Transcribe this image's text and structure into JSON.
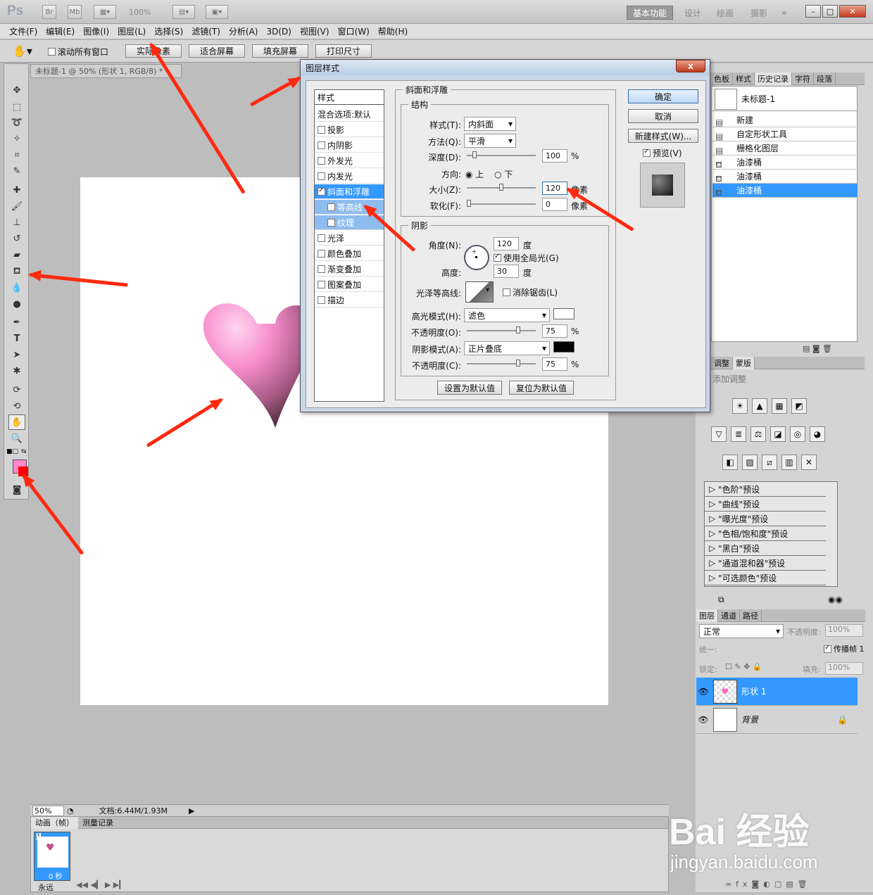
{
  "app": {
    "logo": "Ps",
    "zoom": "100%"
  },
  "topbar": {
    "br": "Br",
    "mb": "Mb",
    "workspaces": [
      "基本功能",
      "设计",
      "绘画",
      "摄影"
    ],
    "more": "»"
  },
  "menu": [
    "文件(F)",
    "编辑(E)",
    "图像(I)",
    "图层(L)",
    "选择(S)",
    "滤镜(T)",
    "分析(A)",
    "3D(D)",
    "视图(V)",
    "窗口(W)",
    "帮助(H)"
  ],
  "options": {
    "scroll_all": "滚动所有窗口",
    "actual_pixels": "实际像素",
    "fit_screen": "适合屏幕",
    "fill_screen": "填充屏幕",
    "print_size": "打印尺寸"
  },
  "document": {
    "tab": "未标题-1 @ 50% (形状 1, RGB/8) *",
    "zoom": "50%",
    "doc_info": "文档:6.44M/1.93M"
  },
  "colors": {
    "foreground": "#ff88cc",
    "background": "#ff0000",
    "selection": "#3399ff"
  },
  "animation": {
    "tabs": [
      "动画（帧）",
      "测量记录"
    ],
    "frame_number": "1",
    "frame_time": "0 秒",
    "loop": "永远"
  },
  "history": {
    "tabs": [
      "色板",
      "样式",
      "历史记录",
      "字符",
      "段落"
    ],
    "snapshot": "未标题-1",
    "items": [
      "新建",
      "自定形状工具",
      "栅格化图层",
      "油漆桶",
      "油漆桶",
      "油漆桶"
    ]
  },
  "adjustments": {
    "tabs": [
      "调整",
      "蒙版"
    ],
    "header": "添加调整",
    "presets": [
      "\"色阶\"预设",
      "\"曲线\"预设",
      "\"曝光度\"预设",
      "\"色相/饱和度\"预设",
      "\"黑白\"预设",
      "\"通道混和器\"预设",
      "\"可选颜色\"预设"
    ]
  },
  "layers": {
    "tabs": [
      "图层",
      "通道",
      "路径"
    ],
    "blend_mode": "正常",
    "opacity_label": "不透明度:",
    "opacity": "100%",
    "unify_label": "统一:",
    "propagate": "传播帧 1",
    "lock_label": "锁定:",
    "fill_label": "填充:",
    "fill": "100%",
    "rows": [
      "形状 1",
      "背景"
    ]
  },
  "dialog": {
    "title": "图层样式",
    "close": "x",
    "styles_header": "样式",
    "blend_options": "混合选项:默认",
    "styles": [
      "投影",
      "内阴影",
      "外发光",
      "内发光",
      "斜面和浮雕",
      "等高线",
      "纹理",
      "光泽",
      "颜色叠加",
      "渐变叠加",
      "图案叠加",
      "描边"
    ],
    "section_title": "斜面和浮雕",
    "structure": "结构",
    "style_label": "样式(T):",
    "style_value": "内斜面",
    "technique_label": "方法(Q):",
    "technique_value": "平滑",
    "depth_label": "深度(D):",
    "depth_value": "100",
    "percent": "%",
    "direction_label": "方向:",
    "dir_up": "上",
    "dir_down": "下",
    "size_label": "大小(Z):",
    "size_value": "120",
    "px": "像素",
    "soften_label": "软化(F):",
    "soften_value": "0",
    "shading": "阴影",
    "angle_label": "角度(N):",
    "angle_value": "120",
    "deg": "度",
    "global_light": "使用全局光(G)",
    "altitude_label": "高度:",
    "altitude_value": "30",
    "gloss_label": "光泽等高线:",
    "antialias": "消除锯齿(L)",
    "highlight_label": "高光模式(H):",
    "highlight_value": "滤色",
    "hl_opacity_label": "不透明度(O):",
    "hl_opacity_value": "75",
    "shadow_label": "阴影模式(A):",
    "shadow_value": "正片叠底",
    "sh_opacity_label": "不透明度(C):",
    "sh_opacity_value": "75",
    "make_default": "设置为默认值",
    "reset_default": "复位为默认值",
    "ok": "确定",
    "cancel": "取消",
    "new_style": "新建样式(W)...",
    "preview": "预览(V)",
    "highlight_color": "#ffffff",
    "shadow_color": "#000000"
  },
  "watermark": {
    "brand": "Bai 经验",
    "url": "jingyan.baidu.com"
  }
}
